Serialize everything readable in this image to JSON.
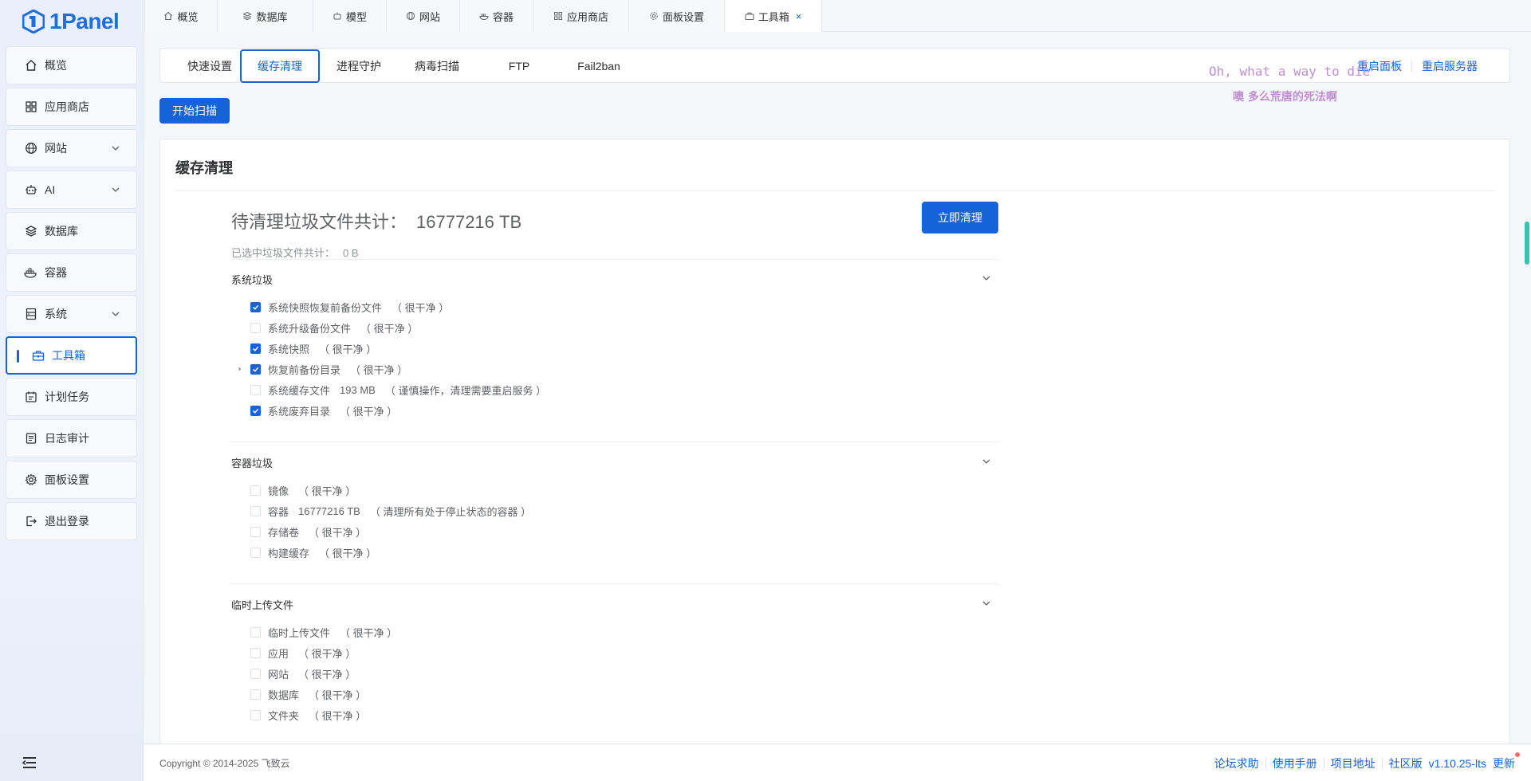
{
  "app": {
    "logo_text": "1Panel"
  },
  "sidebar": {
    "items": [
      {
        "label": "概览",
        "icon": "home-icon"
      },
      {
        "label": "应用商店",
        "icon": "app-store-icon"
      },
      {
        "label": "网站",
        "icon": "globe-icon",
        "expandable": true
      },
      {
        "label": "AI",
        "icon": "robot-icon",
        "expandable": true
      },
      {
        "label": "数据库",
        "icon": "database-icon"
      },
      {
        "label": "容器",
        "icon": "container-icon"
      },
      {
        "label": "系统",
        "icon": "system-icon",
        "expandable": true
      },
      {
        "label": "工具箱",
        "icon": "toolbox-icon",
        "active": true
      },
      {
        "label": "计划任务",
        "icon": "calendar-icon"
      },
      {
        "label": "日志审计",
        "icon": "log-icon"
      },
      {
        "label": "面板设置",
        "icon": "gear-icon"
      },
      {
        "label": "退出登录",
        "icon": "logout-icon"
      }
    ]
  },
  "top_tabs": [
    {
      "label": "概览"
    },
    {
      "label": "数据库"
    },
    {
      "label": "模型"
    },
    {
      "label": "网站"
    },
    {
      "label": "容器"
    },
    {
      "label": "应用商店"
    },
    {
      "label": "面板设置"
    },
    {
      "label": "工具箱",
      "active": true,
      "close": "×"
    }
  ],
  "sub_tabs": [
    {
      "label": "快速设置"
    },
    {
      "label": "缓存清理",
      "active": true
    },
    {
      "label": "进程守护"
    },
    {
      "label": "病毒扫描"
    },
    {
      "label": "FTP"
    },
    {
      "label": "Fail2ban"
    }
  ],
  "restart": {
    "panel": "重启面板",
    "server": "重启服务器"
  },
  "watermark": {
    "en": "Oh, what a way to die",
    "cn": "噢 多么荒唐的死法啊"
  },
  "scan_button": "开始扫描",
  "card": {
    "title": "缓存清理",
    "summary_label": "待清理垃圾文件共计：",
    "summary_value": "16777216 TB",
    "clean_button": "立即清理",
    "selected_label": "已选中垃圾文件共计：",
    "selected_value": "0 B",
    "groups": [
      {
        "title": "系统垃圾",
        "items": [
          {
            "label": "系统快照恢复前备份文件",
            "detail": "（ 很干净 ）",
            "checked": true
          },
          {
            "label": "系统升级备份文件",
            "detail": "（ 很干净 ）",
            "checked": false
          },
          {
            "label": "系统快照",
            "detail": "（ 很干净 ）",
            "checked": true
          },
          {
            "label": "恢复前备份目录",
            "detail": "（ 很干净 ）",
            "checked": true,
            "expandable": true
          },
          {
            "label": "系统缓存文件",
            "size": "193 MB",
            "detail": "（ 谨慎操作，清理需要重启服务 ）",
            "checked": false
          },
          {
            "label": "系统废弃目录",
            "detail": "（ 很干净 ）",
            "checked": true
          }
        ]
      },
      {
        "title": "容器垃圾",
        "items": [
          {
            "label": "镜像",
            "detail": "（ 很干净 ）",
            "checked": false
          },
          {
            "label": "容器",
            "size": "16777216 TB",
            "detail": "（ 清理所有处于停止状态的容器 ）",
            "checked": false
          },
          {
            "label": "存储卷",
            "detail": "（ 很干净 ）",
            "checked": false
          },
          {
            "label": "构建缓存",
            "detail": "（ 很干净 ）",
            "checked": false
          }
        ]
      },
      {
        "title": "临时上传文件",
        "items": [
          {
            "label": "临时上传文件",
            "detail": "（ 很干净 ）",
            "checked": false
          },
          {
            "label": "应用",
            "detail": "（ 很干净 ）",
            "checked": false
          },
          {
            "label": "网站",
            "detail": "（ 很干净 ）",
            "checked": false
          },
          {
            "label": "数据库",
            "detail": "（ 很干净 ）",
            "checked": false
          },
          {
            "label": "文件夹",
            "detail": "（ 很干净 ）",
            "checked": false
          }
        ]
      }
    ]
  },
  "footer": {
    "copyright": "Copyright © 2014-2025 飞致云",
    "links": [
      "论坛求助",
      "使用手册",
      "项目地址",
      "社区版"
    ],
    "version": "v1.10.25-lts",
    "update": "更新"
  },
  "colors": {
    "primary": "#1662d8",
    "watermark": "#c08fd0",
    "scroll_thumb": "#2ec7b1"
  }
}
